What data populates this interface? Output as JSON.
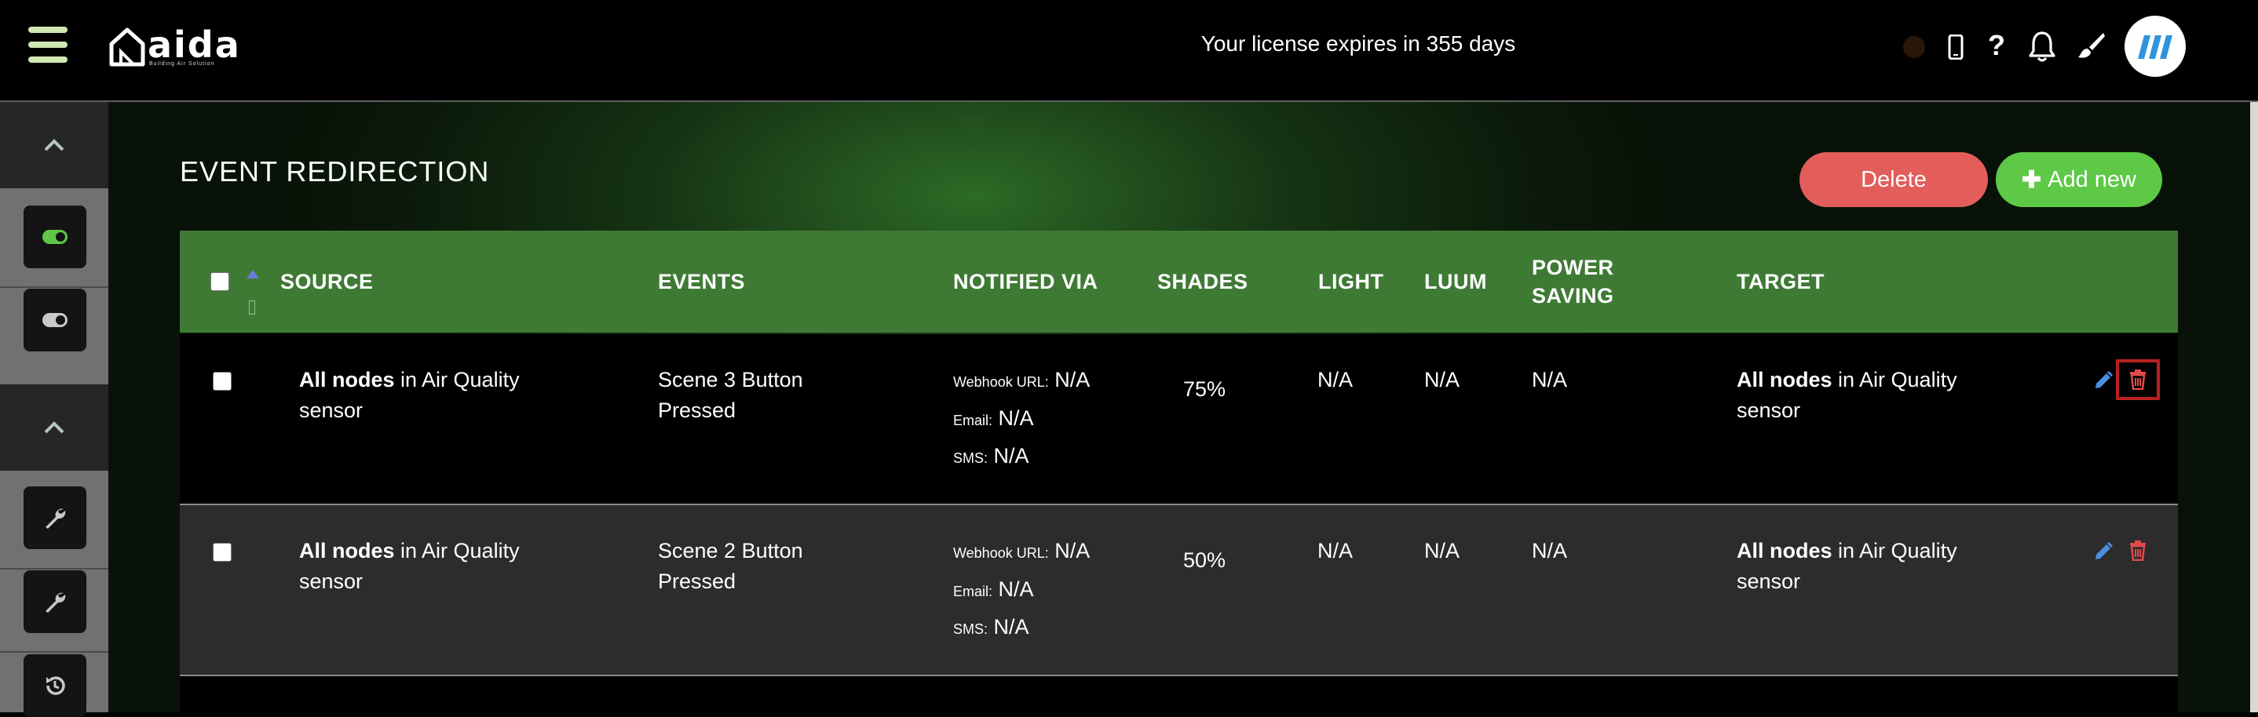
{
  "app": {
    "license_text": "Your license expires in 355 days",
    "logo_text": "aida",
    "logo_tagline": "Building Air Solution"
  },
  "page": {
    "title": "EVENT REDIRECTION"
  },
  "actions": {
    "delete_label": "Delete",
    "add_label": "Add new"
  },
  "colors": {
    "accent_green": "#5ec946",
    "header_green": "#3f7a35",
    "delete_red": "#e35d5b",
    "edit_blue": "#4a8fe0"
  },
  "table": {
    "headers": {
      "source": "SOURCE",
      "events": "EVENTS",
      "notified_via": "NOTIFIED VIA",
      "shades": "SHADES",
      "light": "LIGHT",
      "luum": "LUUM",
      "power_saving_1": "POWER",
      "power_saving_2": "SAVING",
      "target": "TARGET"
    },
    "rows": [
      {
        "source_bold": "All nodes",
        "source_rest": " in Air Quality",
        "source_line2": "sensor",
        "event_line1": "Scene 3 Button",
        "event_line2": "Pressed",
        "webhook_label": "Webhook URL:",
        "webhook_value": "N/A",
        "email_label": "Email:",
        "email_value": "N/A",
        "sms_label": "SMS:",
        "sms_value": "N/A",
        "shades": "75%",
        "light": "N/A",
        "luum": "N/A",
        "power_saving": "N/A",
        "target_bold": "All nodes",
        "target_rest": " in Air Quality",
        "target_line2": "sensor"
      },
      {
        "source_bold": "All nodes",
        "source_rest": " in Air Quality",
        "source_line2": "sensor",
        "event_line1": "Scene 2 Button",
        "event_line2": "Pressed",
        "webhook_label": "Webhook URL:",
        "webhook_value": "N/A",
        "email_label": "Email:",
        "email_value": "N/A",
        "sms_label": "SMS:",
        "sms_value": "N/A",
        "shades": "50%",
        "light": "N/A",
        "luum": "N/A",
        "power_saving": "N/A",
        "target_bold": "All nodes",
        "target_rest": " in Air Quality",
        "target_line2": "sensor"
      }
    ]
  },
  "icons": [
    "menu-icon",
    "logo-house-icon",
    "status-dot-icon",
    "phone-icon",
    "help-icon",
    "bell-icon",
    "brush-icon",
    "avatar",
    "chevron-up-icon",
    "toggle-icon",
    "wrench-icon",
    "history-icon",
    "sort-up-icon",
    "edit-icon",
    "trash-icon"
  ]
}
